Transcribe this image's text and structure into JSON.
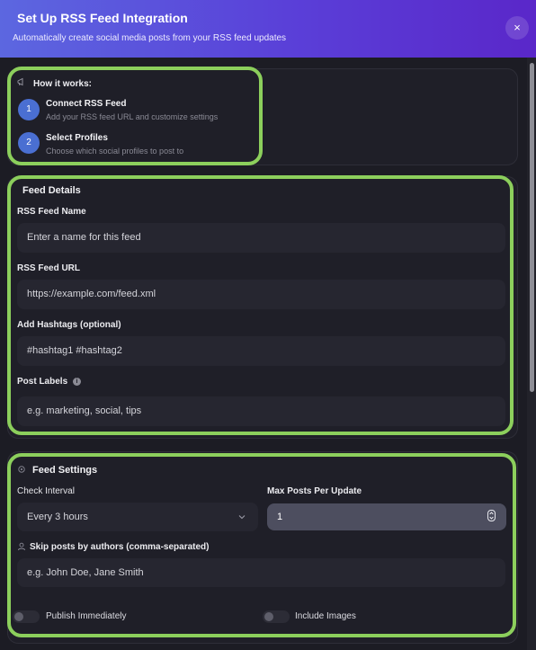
{
  "dialog": {
    "title": "Set Up RSS Feed Integration",
    "subtitle": "Automatically create social media posts from your RSS feed updates",
    "close_icon": "×"
  },
  "how_it_works": {
    "title": "How it works:",
    "steps": [
      {
        "number": "1",
        "title": "Connect RSS Feed",
        "description": "Add your RSS feed URL and customize settings"
      },
      {
        "number": "2",
        "title": "Select Profiles",
        "description": "Choose which social profiles to post to"
      }
    ]
  },
  "feed_details": {
    "title": "Feed Details",
    "name_label": "RSS Feed Name",
    "name_placeholder": "Enter a name for this feed",
    "url_label": "RSS Feed URL",
    "url_placeholder": "https://example.com/feed.xml",
    "hashtags_label": "Add Hashtags (optional)",
    "hashtags_placeholder": "#hashtag1 #hashtag2",
    "labels_label": "Post Labels",
    "labels_info_icon": "i",
    "labels_placeholder": "e.g. marketing, social, tips"
  },
  "feed_settings": {
    "title": "Feed Settings",
    "interval_label": "Check Interval",
    "interval_value": "Every 3 hours",
    "max_posts_label": "Max Posts Per Update",
    "max_posts_value": "1",
    "skip_label": "Skip posts by authors (comma-separated)",
    "skip_placeholder": "e.g. John Doe, Jane Smith",
    "publish_label": "Publish Immediately",
    "publish_on": false,
    "images_label": "Include Images",
    "images_on": false
  },
  "colors": {
    "header_start": "#5c67e0",
    "header_end": "#5a27c9",
    "highlight": "#8ccf5c",
    "step_badge": "#4a6fd2"
  },
  "icons": {
    "how_icon": "megaphone-icon",
    "settings_icon": "gear-icon",
    "user_icon": "user-icon",
    "chevron": "chevron-down-icon",
    "spinner": "stepper-icon"
  }
}
